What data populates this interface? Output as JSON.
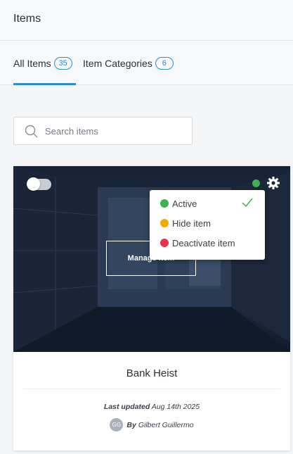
{
  "header": {
    "title": "Items"
  },
  "tabs": [
    {
      "label": "All Items",
      "count": "35"
    },
    {
      "label": "Item Categories",
      "count": "6"
    }
  ],
  "search": {
    "placeholder": "Search items",
    "value": ""
  },
  "card": {
    "title": "Bank Heist",
    "manage_label": "Manage item",
    "last_updated_label": "Last updated",
    "last_updated_value": "Aug 14th 2025",
    "by_label": "By",
    "author_name": "Gilbert Guillermo",
    "author_initials": "GG",
    "status_color": "#3fb24f"
  },
  "status_menu": [
    {
      "label": "Active",
      "color": "#3fb24f",
      "selected": true
    },
    {
      "label": "Hide item",
      "color": "#f0ad00",
      "selected": false
    },
    {
      "label": "Deactivate item",
      "color": "#e8334a",
      "selected": false
    }
  ],
  "colors": {
    "accent": "#2a8fd6"
  }
}
